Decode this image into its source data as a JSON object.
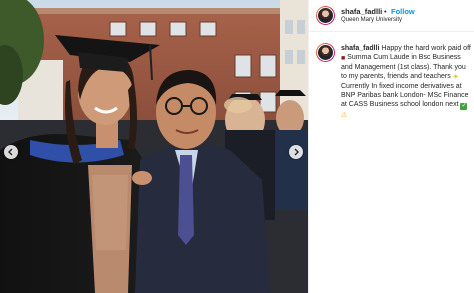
{
  "post": {
    "username": "shafa_fadlli",
    "separator": "•",
    "follow_label": "Follow",
    "location": "Queen Mary University"
  },
  "caption": {
    "username": "shafa_fadlli",
    "line1": " Happy the hard work paid off ",
    "line2": " Summa Cum Laude in Bsc Business and Management (1st class). Thank you to my parents, friends and teachers ",
    "line3": " Currently In fixed income derivatives at BNP Paribas bank London- MSc Finance at CASS Business school london next ",
    "emojis": [
      "book-emoji",
      "sun-emoji",
      "check-emoji",
      "warning-emoji"
    ]
  },
  "photo": {
    "description_icons": [
      "chevron-left-icon",
      "chevron-right-icon"
    ]
  },
  "colors": {
    "link_blue": "#0095f6",
    "text": "#262626",
    "border": "#efefef"
  }
}
